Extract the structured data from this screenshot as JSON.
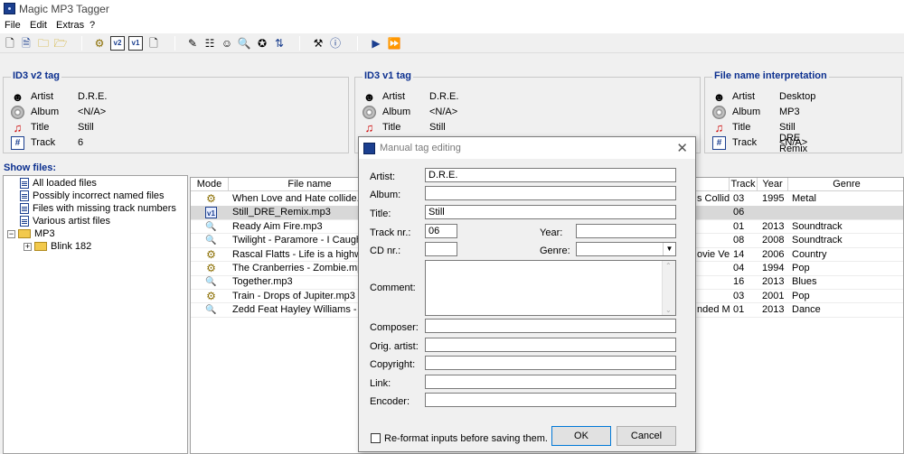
{
  "window": {
    "title": "Magic MP3 Tagger"
  },
  "menu": [
    "File",
    "Edit",
    "Extras",
    "?"
  ],
  "toolbar": {
    "v2_label": "v2",
    "v1_label": "v1"
  },
  "panels": {
    "id3v2": {
      "title": "ID3 v2 tag",
      "fields": [
        {
          "label": "Artist",
          "value": "D.R.E."
        },
        {
          "label": "Album",
          "value": "<N/A>"
        },
        {
          "label": "Title",
          "value": "Still"
        },
        {
          "label": "Track",
          "value": "6"
        }
      ]
    },
    "id3v1": {
      "title": "ID3 v1 tag",
      "fields": [
        {
          "label": "Artist",
          "value": "D.R.E."
        },
        {
          "label": "Album",
          "value": "<N/A>"
        },
        {
          "label": "Title",
          "value": "Still"
        }
      ]
    },
    "filename": {
      "title": "File name interpretation",
      "fields": [
        {
          "label": "Artist",
          "value": "Desktop"
        },
        {
          "label": "Album",
          "value": "MP3"
        },
        {
          "label": "Title",
          "value": "Still DRE Remix"
        },
        {
          "label": "Track",
          "value": "<N/A>"
        }
      ]
    }
  },
  "tree": {
    "header": "Show files:",
    "items": [
      "All loaded files",
      "Possibly incorrect named files",
      "Files with missing track numbers",
      "Various artist files",
      "MP3",
      "Blink 182"
    ]
  },
  "table": {
    "columns": {
      "mode": "Mode",
      "filename": "File name",
      "track": "Track",
      "year": "Year",
      "genre": "Genre"
    },
    "rows": [
      {
        "mode": "gear",
        "file": "When Love and Hate collide.mp3",
        "mid": "s Collide",
        "track": "03",
        "year": "1995",
        "genre": "Metal"
      },
      {
        "mode": "v1",
        "file": "Still_DRE_Remix.mp3",
        "mid": "",
        "track": "06",
        "year": "",
        "genre": ""
      },
      {
        "mode": "mag",
        "file": "Ready Aim Fire.mp3",
        "mid": "",
        "track": "01",
        "year": "2013",
        "genre": "Soundtrack"
      },
      {
        "mode": "mag",
        "file": "Twilight - Paramore - I Caught Myse",
        "mid": "",
        "track": "08",
        "year": "2008",
        "genre": "Soundtrack"
      },
      {
        "mode": "gear",
        "file": "Rascal Flatts - Life is a highway.mp",
        "mid": "ovie Ver:",
        "track": "14",
        "year": "2006",
        "genre": "Country"
      },
      {
        "mode": "gear",
        "file": "The Cranberries - Zombie.mp3",
        "mid": "",
        "track": "04",
        "year": "1994",
        "genre": "Pop"
      },
      {
        "mode": "mag",
        "file": "Together.mp3",
        "mid": "",
        "track": "16",
        "year": "2013",
        "genre": "Blues"
      },
      {
        "mode": "gear",
        "file": "Train - Drops of Jupiter.mp3",
        "mid": "",
        "track": "03",
        "year": "2001",
        "genre": "Pop"
      },
      {
        "mode": "mag",
        "file": "Zedd Feat Hayley Williams - Stay T",
        "mid": "nded Mi:",
        "track": "01",
        "year": "2013",
        "genre": "Dance"
      }
    ]
  },
  "dialog": {
    "title": "Manual tag editing",
    "artist_label": "Artist:",
    "artist": "D.R.E.",
    "album_label": "Album:",
    "album": "",
    "title_label": "Title:",
    "title_value": "Still",
    "track_label": "Track nr.:",
    "track": "06",
    "year_label": "Year:",
    "year": "",
    "cd_label": "CD nr.:",
    "cd": "",
    "genre_label": "Genre:",
    "genre": "",
    "comment_label": "Comment:",
    "comment": "",
    "composer_label": "Composer:",
    "composer": "",
    "orig_artist_label": "Orig. artist:",
    "orig_artist": "",
    "copyright_label": "Copyright:",
    "copyright": "",
    "link_label": "Link:",
    "link": "",
    "encoder_label": "Encoder:",
    "encoder": "",
    "reformat_label": "Re-format inputs before saving them.",
    "reformat_checked": false,
    "ok_label": "OK",
    "cancel_label": "Cancel"
  }
}
